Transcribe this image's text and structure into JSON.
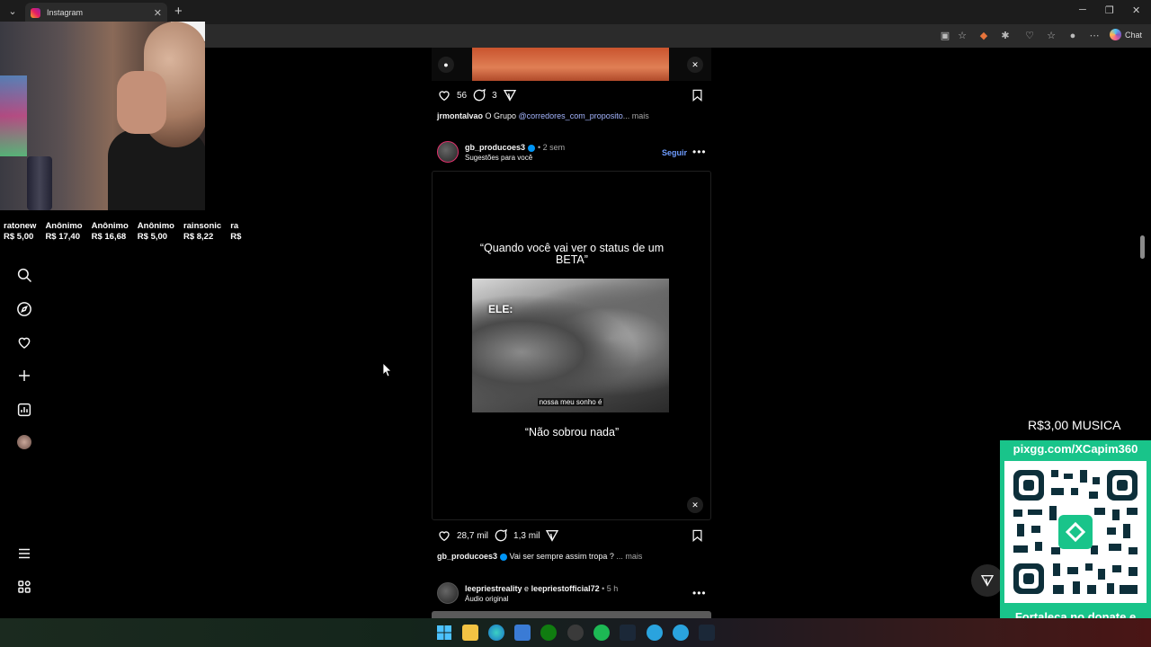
{
  "browser": {
    "tab_title": "Instagram",
    "chat_label": "Chat"
  },
  "feed": {
    "post1": {
      "likes": "56",
      "comments": "3",
      "caption_user": "jrmontalvao",
      "caption_text": " O Grupo ",
      "caption_link": "@corredores_com_proposito",
      "caption_more": "... mais"
    },
    "post2": {
      "username": "gb_producoes3",
      "time": "• 2 sem",
      "subtitle": "Sugestões para você",
      "follow_label": "Seguir",
      "reel_title": "“Quando você vai ver o status de um BETA”",
      "reel_label": "ELE:",
      "reel_subtitle": "nossa meu sonho é",
      "reel_bottom": "“Não sobrou nada”",
      "likes": "28,7 mil",
      "comments": "1,3 mil",
      "caption_user": "gb_producoes3",
      "caption_text": " Vai ser sempre assim tropa ? ",
      "caption_more": "... mais"
    },
    "post3": {
      "username": "leepriestreality",
      "joiner": " e ",
      "username2": "leepriestofficial72",
      "time": " • 5 h",
      "subtitle": "Áudio original"
    }
  },
  "stream": {
    "donors": [
      {
        "name": "ratonew",
        "amount": "R$ 5,00"
      },
      {
        "name": "Anônimo",
        "amount": "R$ 17,40"
      },
      {
        "name": "Anônimo",
        "amount": "R$ 16,68"
      },
      {
        "name": "Anônimo",
        "amount": "R$ 5,00"
      },
      {
        "name": "rainsonic",
        "amount": "R$ 8,22"
      },
      {
        "name": "ra",
        "amount": "R$"
      }
    ],
    "music_label": "R$3,00 MUSICA",
    "pix_url": "pixgg.com/XCapim360",
    "message": "Fortaleça no donate e envie sua mensagem!"
  },
  "colors": {
    "accent_link": "#a5b6ff",
    "follow_blue": "#6e9cff",
    "verified": "#0095f6",
    "pix_green": "#19c48a"
  },
  "icons": [
    "search-icon",
    "compass-icon",
    "heart-icon",
    "plus-icon",
    "dashboard-icon",
    "menu-icon",
    "apps-icon",
    "share-icon",
    "bookmark-icon",
    "comment-icon",
    "mute-icon"
  ]
}
